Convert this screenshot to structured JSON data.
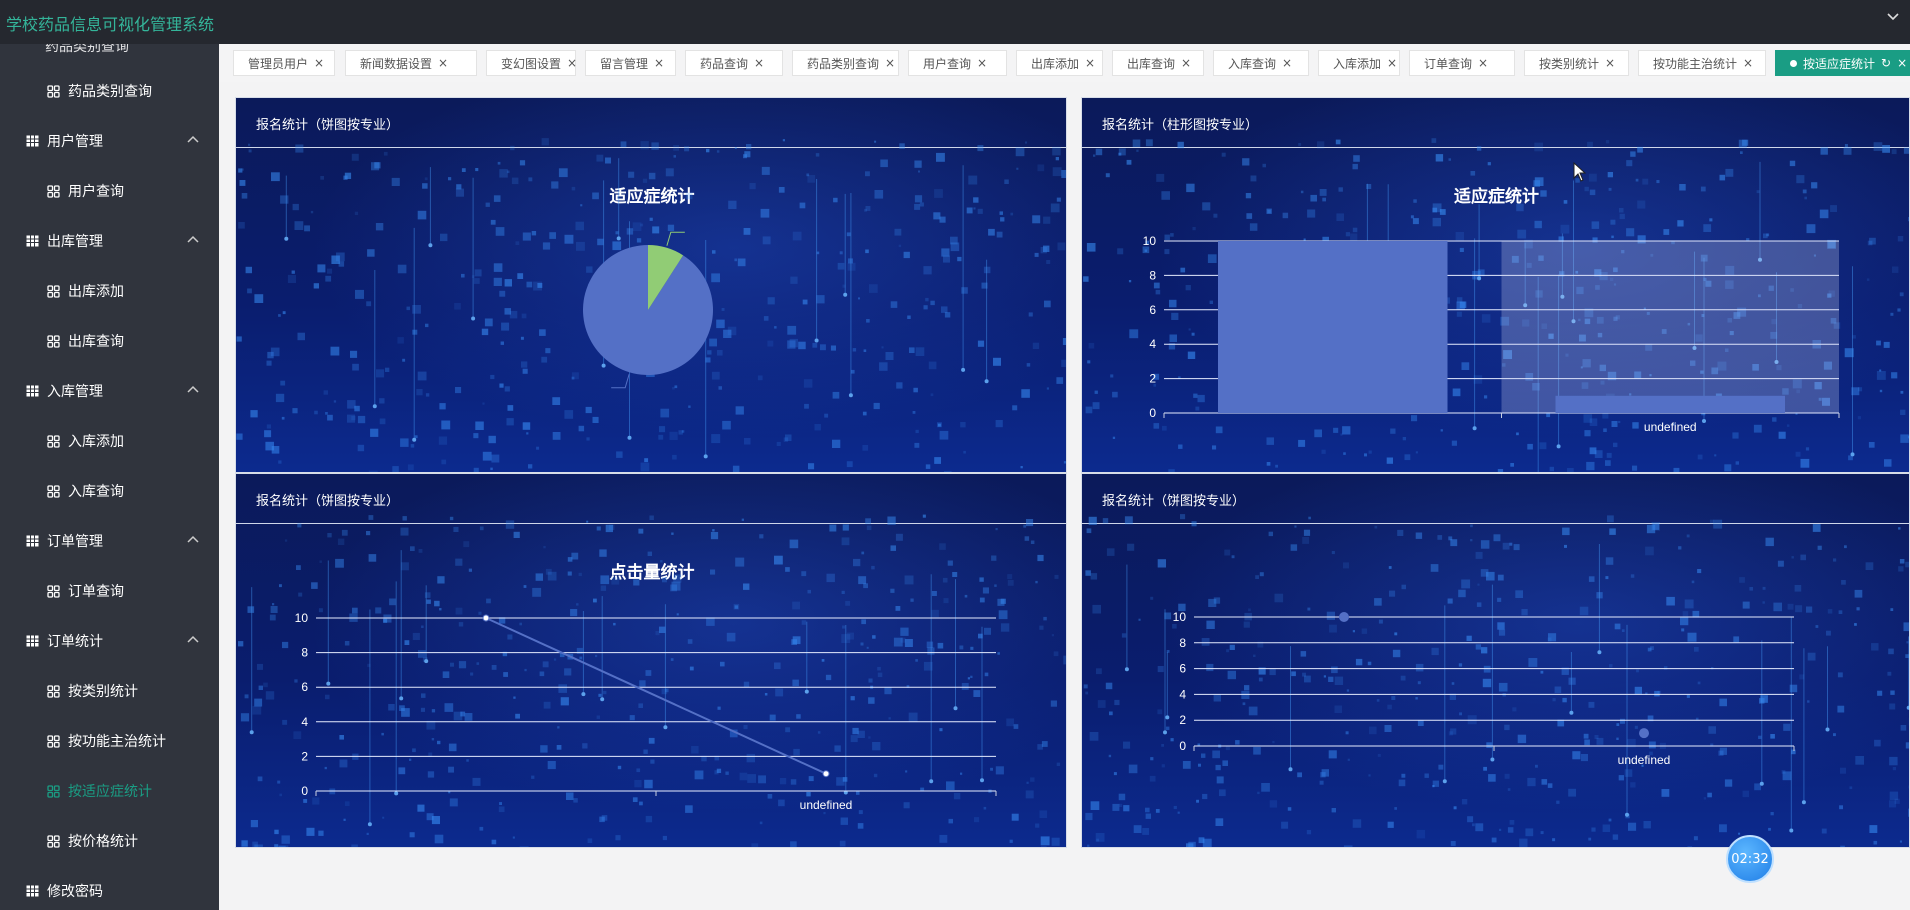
{
  "app": {
    "title": "学校药品信息可视化管理系统"
  },
  "sidebar": {
    "clipped_item": "药品类别查询",
    "items": [
      {
        "label": "药品类别查询",
        "kind": "sub",
        "icon": "grid-icon"
      },
      {
        "label": "用户管理",
        "kind": "group",
        "icon": "table-icon"
      },
      {
        "label": "用户查询",
        "kind": "sub",
        "icon": "grid-icon"
      },
      {
        "label": "出库管理",
        "kind": "group",
        "icon": "table-icon"
      },
      {
        "label": "出库添加",
        "kind": "sub",
        "icon": "grid-icon"
      },
      {
        "label": "出库查询",
        "kind": "sub",
        "icon": "grid-icon"
      },
      {
        "label": "入库管理",
        "kind": "group",
        "icon": "table-icon"
      },
      {
        "label": "入库添加",
        "kind": "sub",
        "icon": "grid-icon"
      },
      {
        "label": "入库查询",
        "kind": "sub",
        "icon": "grid-icon"
      },
      {
        "label": "订单管理",
        "kind": "group",
        "icon": "table-icon"
      },
      {
        "label": "订单查询",
        "kind": "sub",
        "icon": "grid-icon"
      },
      {
        "label": "订单统计",
        "kind": "group",
        "icon": "table-icon"
      },
      {
        "label": "按类别统计",
        "kind": "sub",
        "icon": "grid-icon"
      },
      {
        "label": "按功能主治统计",
        "kind": "sub",
        "icon": "grid-icon"
      },
      {
        "label": "按适应症统计",
        "kind": "sub",
        "icon": "grid-icon",
        "active": true
      },
      {
        "label": "按价格统计",
        "kind": "sub",
        "icon": "grid-icon"
      },
      {
        "label": "修改密码",
        "kind": "group",
        "icon": "table-icon"
      }
    ]
  },
  "tabs": [
    {
      "label": "管理员用户"
    },
    {
      "label": "新闻数据设置"
    },
    {
      "label": "变幻图设置"
    },
    {
      "label": "留言管理"
    },
    {
      "label": "药品查询"
    },
    {
      "label": "药品类别查询"
    },
    {
      "label": "用户查询"
    },
    {
      "label": "出库添加"
    },
    {
      "label": "出库查询"
    },
    {
      "label": "入库查询"
    },
    {
      "label": "入库添加"
    },
    {
      "label": "订单查询"
    },
    {
      "label": "按类别统计"
    },
    {
      "label": "按功能主治统计"
    },
    {
      "label": "按适应症统计",
      "active": true
    }
  ],
  "panels": [
    {
      "title": "报名统计（饼图按专业）"
    },
    {
      "title": "报名统计（柱形图按专业）"
    },
    {
      "title": "报名统计（饼图按专业）"
    },
    {
      "title": "报名统计（饼图按专业）"
    }
  ],
  "timer": "02:32",
  "colors": {
    "accent": "#1a9d84",
    "series": "#5470c6",
    "slice2": "#91cc75"
  },
  "chart_data": [
    {
      "type": "pie",
      "title": "适应症统计",
      "slices": [
        {
          "name": "",
          "value": 10,
          "color": "#5470c6"
        },
        {
          "name": "",
          "value": 1,
          "color": "#91cc75"
        }
      ]
    },
    {
      "type": "bar",
      "title": "适应症统计",
      "categories": [
        "",
        "undefined"
      ],
      "values": [
        10,
        1
      ],
      "ylim": [
        0,
        10
      ],
      "yticks": [
        0,
        2,
        4,
        6,
        8,
        10
      ],
      "grid": true
    },
    {
      "type": "line",
      "title": "点击量统计",
      "categories": [
        "",
        "undefined"
      ],
      "values": [
        10,
        1
      ],
      "ylim": [
        0,
        10
      ],
      "yticks": [
        0,
        2,
        4,
        6,
        8,
        10
      ],
      "grid": true
    },
    {
      "type": "scatter",
      "title": "",
      "categories": [
        "",
        "undefined"
      ],
      "values": [
        10,
        1
      ],
      "ylim": [
        0,
        10
      ],
      "yticks": [
        0,
        2,
        4,
        6,
        8,
        10
      ],
      "grid": true
    }
  ]
}
